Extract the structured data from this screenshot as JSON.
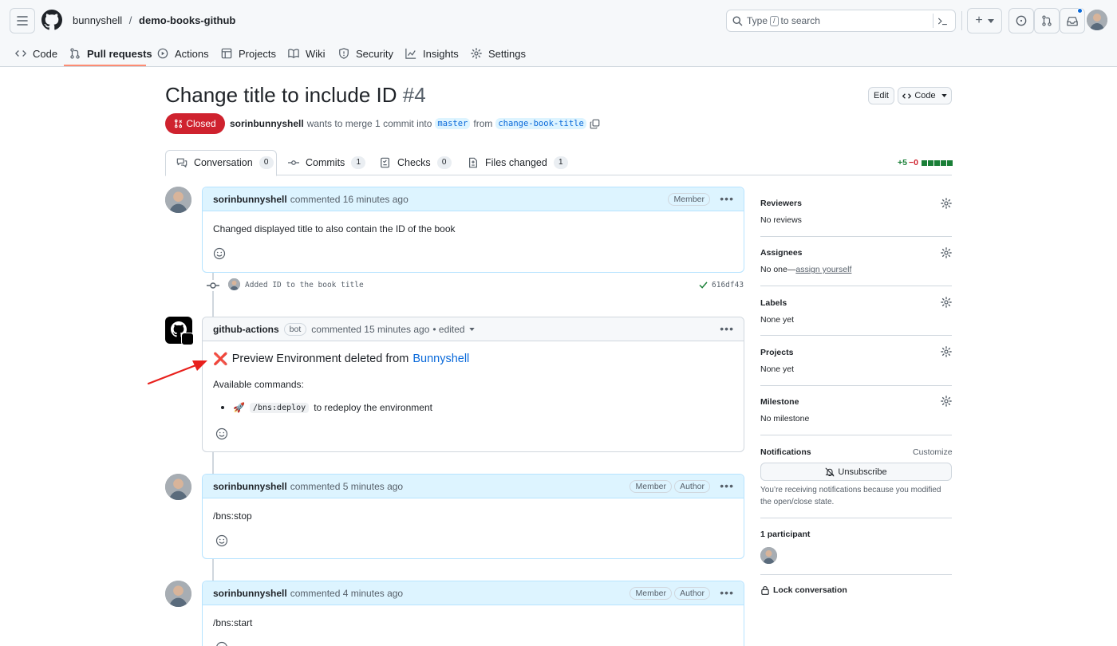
{
  "header": {
    "owner": "bunnyshell",
    "separator": "/",
    "repo": "demo-books-github",
    "search_placeholder_pre": "Type",
    "search_key": "/",
    "search_placeholder_post": "to search",
    "plus_label": "+"
  },
  "nav": {
    "tabs": [
      {
        "label": "Code",
        "icon": "code-icon"
      },
      {
        "label": "Pull requests",
        "icon": "pull-request-icon",
        "active": true
      },
      {
        "label": "Actions",
        "icon": "play-icon"
      },
      {
        "label": "Projects",
        "icon": "table-icon"
      },
      {
        "label": "Wiki",
        "icon": "book-icon"
      },
      {
        "label": "Security",
        "icon": "shield-icon"
      },
      {
        "label": "Insights",
        "icon": "graph-icon"
      },
      {
        "label": "Settings",
        "icon": "gear-icon"
      }
    ]
  },
  "pr": {
    "title": "Change title to include ID",
    "number": "#4",
    "state": "Closed",
    "author": "sorinbunnyshell",
    "merge_text": "wants to merge 1 commit into",
    "base_branch": "master",
    "from_text": "from",
    "head_branch": "change-book-title",
    "edit_label": "Edit",
    "code_label": "Code",
    "diff_add": "+5",
    "diff_del": "−0"
  },
  "tabs": [
    {
      "label": "Conversation",
      "count": "0"
    },
    {
      "label": "Commits",
      "count": "1"
    },
    {
      "label": "Checks",
      "count": "0"
    },
    {
      "label": "Files changed",
      "count": "1"
    }
  ],
  "timeline": {
    "comment1": {
      "author": "sorinbunnyshell",
      "meta": "commented 16 minutes ago",
      "badge": "Member",
      "body": "Changed displayed title to also contain the ID of the book"
    },
    "commit": {
      "message": "Added ID to the book title",
      "sha": "616df43"
    },
    "comment2": {
      "author": "github-actions",
      "bot_label": "bot",
      "meta": "commented 15 minutes ago",
      "edited": "• edited",
      "heading_prefix": "Preview Environment deleted from",
      "heading_link": "Bunnyshell",
      "available": "Available commands:",
      "command": "/bns:deploy",
      "command_desc": "to redeploy the environment",
      "emoji_cross": "❌",
      "emoji_rocket": "🚀"
    },
    "comment3": {
      "author": "sorinbunnyshell",
      "meta": "commented 5 minutes ago",
      "badge1": "Member",
      "badge2": "Author",
      "body": "/bns:stop"
    },
    "comment4": {
      "author": "sorinbunnyshell",
      "meta": "commented 4 minutes ago",
      "badge1": "Member",
      "badge2": "Author",
      "body": "/bns:start"
    }
  },
  "sidebar": {
    "reviewers": {
      "title": "Reviewers",
      "value": "No reviews"
    },
    "assignees": {
      "title": "Assignees",
      "value": "No one—",
      "link": "assign yourself"
    },
    "labels": {
      "title": "Labels",
      "value": "None yet"
    },
    "projects": {
      "title": "Projects",
      "value": "None yet"
    },
    "milestone": {
      "title": "Milestone",
      "value": "No milestone"
    },
    "notifications": {
      "title": "Notifications",
      "customize": "Customize",
      "button": "Unsubscribe",
      "note": "You’re receiving notifications because you modified the open/close state."
    },
    "participants": {
      "title": "1 participant"
    },
    "lock": "Lock conversation"
  },
  "colors": {
    "closed_red": "#cf222e",
    "link_blue": "#0969da",
    "add_green": "#1a7f37",
    "annotation_arrow": "#e8201c"
  }
}
